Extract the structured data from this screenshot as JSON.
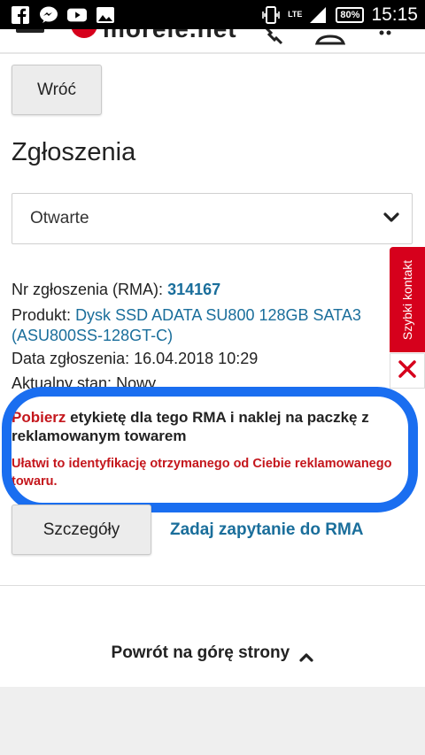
{
  "status_bar": {
    "network": "LTE",
    "battery": "80%",
    "time": "15:15",
    "icons": [
      "facebook-icon",
      "messenger-icon",
      "youtube-icon",
      "gallery-icon",
      "vibrate-icon",
      "signal-icon"
    ]
  },
  "header": {
    "logo_text": "morele.net"
  },
  "back_button": "Wróć",
  "page_title": "Zgłoszenia",
  "filter": {
    "selected": "Otwarte"
  },
  "rma": {
    "number_label": "Nr zgłoszenia (RMA):",
    "number_value": "314167",
    "product_label": "Produkt:",
    "product_value": "Dysk SSD ADATA SU800 128GB SATA3 (ASU800SS-128GT-C)",
    "date_label": "Data zgłoszenia:",
    "date_value": "16.04.2018 10:29",
    "status_label": "Aktualny stan:",
    "status_value": "Nowy"
  },
  "notice": {
    "link_text": "Pobierz",
    "text": " etykietę dla tego RMA i naklej na paczkę z reklamowanym towarem",
    "hint": "Ułatwi to identyfikację otrzymanego od Ciebie reklamowanego towaru."
  },
  "actions": {
    "details_button": "Szczegóły",
    "ask_link": "Zadaj zapytanie do RMA"
  },
  "back_to_top": "Powrót na górę strony",
  "quick_contact": {
    "label": "Szybki kontakt"
  },
  "colors": {
    "brand_red": "#d6001c",
    "link_blue": "#1a6e9b",
    "marker_blue": "#1a6ef0"
  }
}
